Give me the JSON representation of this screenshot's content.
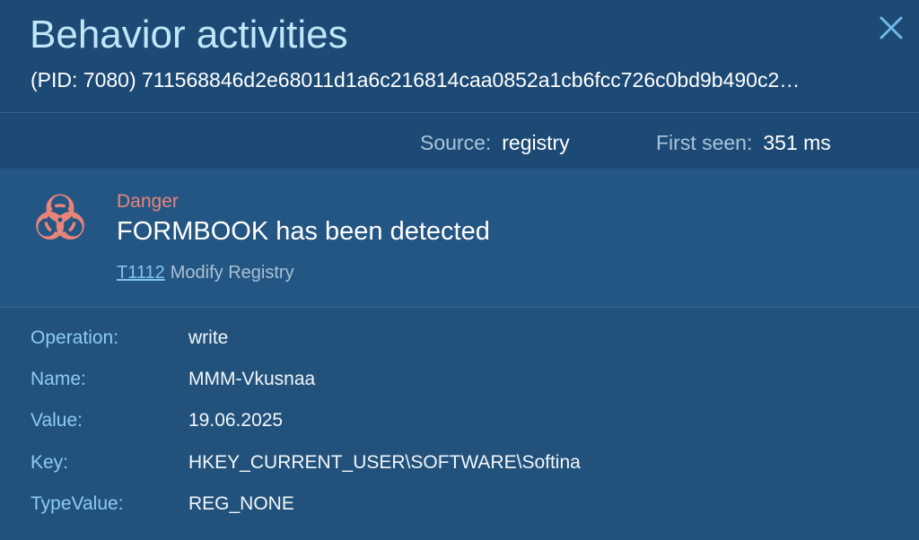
{
  "header": {
    "title": "Behavior activities",
    "pid_line": "(PID: 7080) 711568846d2e68011d1a6c216814caa0852a1cb6fcc726c0bd9b490c2…"
  },
  "meta": {
    "source_label": "Source:",
    "source_value": "registry",
    "first_seen_label": "First seen:",
    "first_seen_value": "351 ms"
  },
  "alert": {
    "level": "Danger",
    "message": "FORMBOOK has been detected",
    "technique_id": "T1112",
    "technique_name": "Modify Registry",
    "icon": "biohazard-icon",
    "level_color": "#e8847a"
  },
  "details": [
    {
      "label": "Operation:",
      "value": "write"
    },
    {
      "label": "Name:",
      "value": "MMM-Vkusnaa"
    },
    {
      "label": "Value:",
      "value": "19.06.2025"
    },
    {
      "label": "Key:",
      "value": "HKEY_CURRENT_USER\\SOFTWARE\\Softina"
    },
    {
      "label": "TypeValue:",
      "value": "REG_NONE"
    }
  ],
  "colors": {
    "background": "#22527c",
    "header": "#1d4a75",
    "title": "#bfe6f8",
    "label": "#8ecbef",
    "link": "#7fc3ef"
  }
}
